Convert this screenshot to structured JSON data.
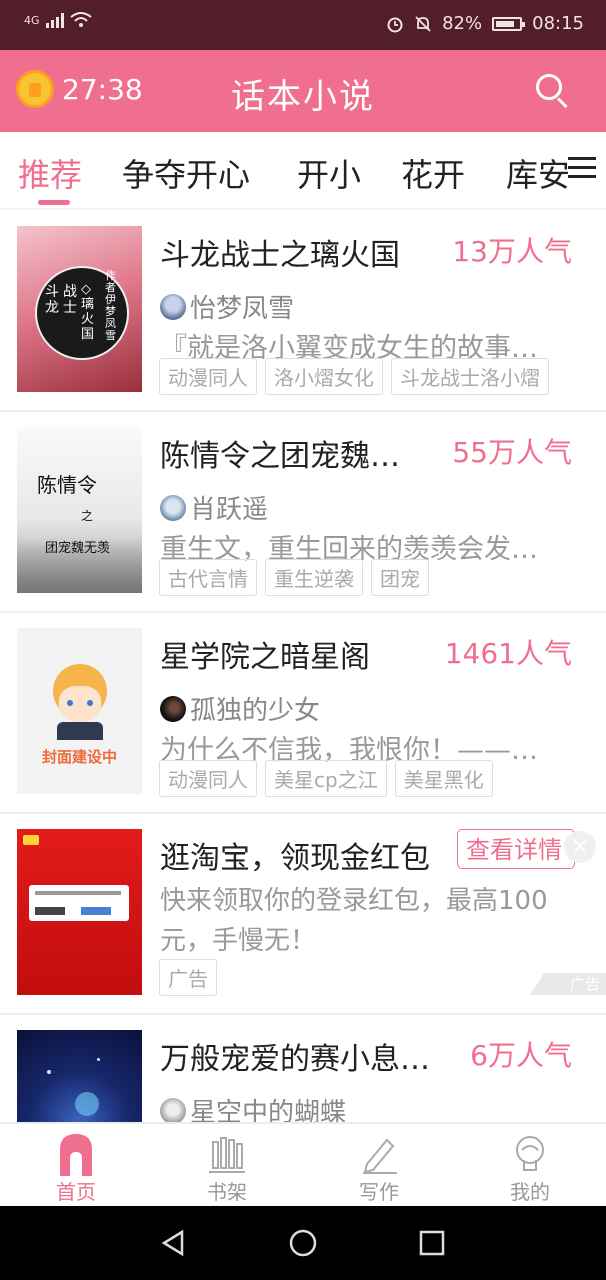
{
  "status_bar": {
    "network": "4G",
    "battery": "82%",
    "battery_level": 0.82,
    "time": "08:15"
  },
  "header": {
    "timer": "27:38",
    "title": "话本小说"
  },
  "tabs": [
    {
      "label": "推荐",
      "active": true
    },
    {
      "label": "争夺开心",
      "active": false
    },
    {
      "label": "开小",
      "active": false
    },
    {
      "label": "花开",
      "active": false
    },
    {
      "label": "库安",
      "active": false
    }
  ],
  "books": [
    {
      "title": "斗龙战士之璃火国",
      "popularity": "13万人气",
      "author": "怡梦凤雪",
      "description": "『就是洛小翼变成女生的故事…",
      "tags": [
        "动漫同人",
        "洛小熠女化",
        "斗龙战士洛小熠"
      ],
      "cover_text": [
        "斗",
        "龙",
        "战",
        "士",
        "◇",
        "璃",
        "火",
        "国"
      ],
      "cover_author": "作者伊梦凤雪"
    },
    {
      "title": "陈情令之团宠魏…",
      "popularity": "55万人气",
      "author": "肖跃遥",
      "description": "重生文，重生回来的羡羡会发…",
      "tags": [
        "古代言情",
        "重生逆袭",
        "团宠"
      ],
      "cover_text": [
        "陈情令",
        "之",
        "团宠魏无羡"
      ]
    },
    {
      "title": "星学院之暗星阁",
      "popularity": "1461人气",
      "author": "孤独的少女",
      "description": "为什么不信我，我恨你！——…",
      "tags": [
        "动漫同人",
        "美星cp之江",
        "美星黑化"
      ],
      "cover_text": [
        "封面建设中"
      ]
    }
  ],
  "ad": {
    "title": "逛淘宝，领现金红包",
    "button": "查看详情",
    "close": "×",
    "description": "快来领取你的登录红包，最高100元，手慢无！",
    "tag": "广告",
    "corner_label": "广告"
  },
  "partial_book": {
    "title": "万般宠爱的赛小息…",
    "popularity": "6万人气",
    "author": "星空中的蝴蝶"
  },
  "bottom_nav": [
    {
      "label": "首页",
      "active": true
    },
    {
      "label": "书架",
      "active": false
    },
    {
      "label": "写作",
      "active": false
    },
    {
      "label": "我的",
      "active": false
    }
  ],
  "colors": {
    "accent": "#f16f8e",
    "status_bar": "#521e2a"
  }
}
